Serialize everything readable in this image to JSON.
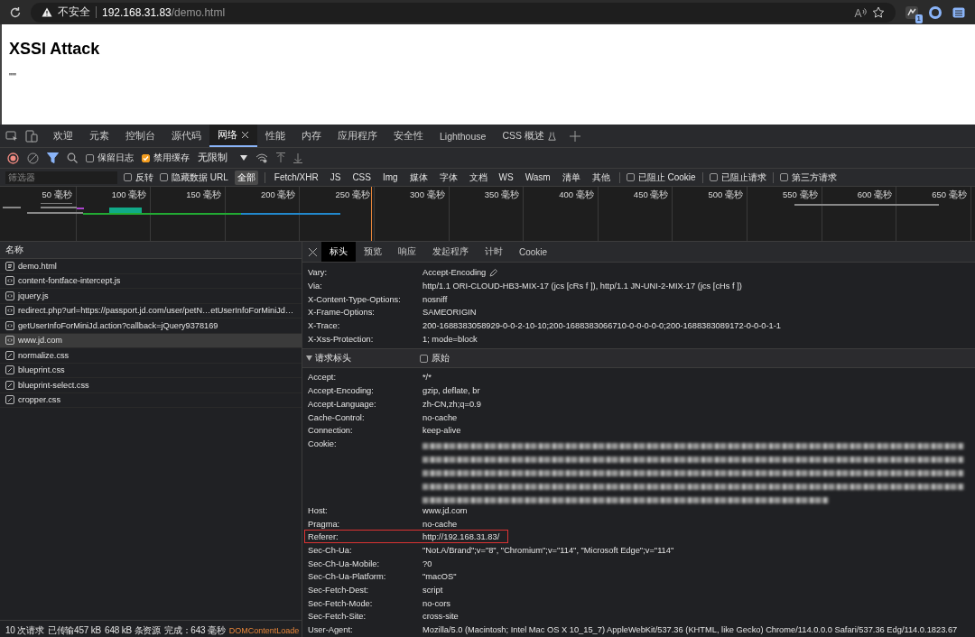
{
  "browser": {
    "security_label": "不安全",
    "url_host": "192.168.31.83",
    "url_path": "/demo.html",
    "extension_badge": "1"
  },
  "page": {
    "heading": "XSSI Attack",
    "body_text": "\"\""
  },
  "devtools_tabs": [
    {
      "label": "欢迎",
      "selected": false
    },
    {
      "label": "元素",
      "selected": false
    },
    {
      "label": "控制台",
      "selected": false
    },
    {
      "label": "源代码",
      "selected": false
    },
    {
      "label": "网络",
      "selected": true,
      "closable": true
    },
    {
      "label": "性能",
      "selected": false
    },
    {
      "label": "内存",
      "selected": false
    },
    {
      "label": "应用程序",
      "selected": false
    },
    {
      "label": "安全性",
      "selected": false
    },
    {
      "label": "Lighthouse",
      "selected": false
    },
    {
      "label": "CSS 概述",
      "selected": false,
      "experimental": true
    }
  ],
  "toolbar": {
    "recording": true,
    "filter_active": true,
    "preserve_log": {
      "label": "保留日志",
      "checked": false
    },
    "disable_cache": {
      "label": "禁用缓存",
      "checked": true
    },
    "throttling": "无限制"
  },
  "filter_bar": {
    "placeholder": "筛选器",
    "invert": {
      "label": "反转",
      "checked": false
    },
    "hide_data_urls": {
      "label": "隐藏数据 URL",
      "checked": false
    },
    "types": [
      {
        "label": "全部",
        "selected": true
      },
      {
        "label": "Fetch/XHR",
        "selected": false
      },
      {
        "label": "JS",
        "selected": false
      },
      {
        "label": "CSS",
        "selected": false
      },
      {
        "label": "Img",
        "selected": false
      },
      {
        "label": "媒体",
        "selected": false
      },
      {
        "label": "字体",
        "selected": false
      },
      {
        "label": "文档",
        "selected": false
      },
      {
        "label": "WS",
        "selected": false
      },
      {
        "label": "Wasm",
        "selected": false
      },
      {
        "label": "清单",
        "selected": false
      },
      {
        "label": "其他",
        "selected": false
      }
    ],
    "toggles": [
      {
        "label": "已阻止 Cookie",
        "checked": false
      },
      {
        "label": "已阻止请求",
        "checked": false
      },
      {
        "label": "第三方请求",
        "checked": false
      }
    ]
  },
  "timeline": {
    "ticks": [
      "50 毫秒",
      "100 毫秒",
      "150 毫秒",
      "200 毫秒",
      "250 毫秒",
      "300 毫秒",
      "350 毫秒",
      "400 毫秒",
      "450 毫秒",
      "500 毫秒",
      "550 毫秒",
      "600 毫秒",
      "650 毫秒"
    ]
  },
  "requests": {
    "column": "名称",
    "rows": [
      {
        "name": "demo.html",
        "kind": "document",
        "selected": false
      },
      {
        "name": "content-fontface-intercept.js",
        "kind": "script",
        "selected": false
      },
      {
        "name": "jquery.js",
        "kind": "script",
        "selected": false
      },
      {
        "name": "redirect.php?url=https://passport.jd.com/user/petN…etUserInfoForMiniJd…",
        "kind": "script",
        "selected": false
      },
      {
        "name": "getUserInfoForMiniJd.action?callback=jQuery9378169",
        "kind": "script",
        "selected": false
      },
      {
        "name": "www.jd.com",
        "kind": "script",
        "selected": true
      },
      {
        "name": "normalize.css",
        "kind": "stylesheet",
        "selected": false
      },
      {
        "name": "blueprint.css",
        "kind": "stylesheet",
        "selected": false
      },
      {
        "name": "blueprint-select.css",
        "kind": "stylesheet",
        "selected": false
      },
      {
        "name": "cropper.css",
        "kind": "stylesheet",
        "selected": false
      }
    ]
  },
  "status_bar": [
    "10 次请求",
    "已传输457 kB",
    "648 kB 条资源",
    "完成：643 毫秒",
    "DOMContentLoade"
  ],
  "detail_tabs": [
    {
      "label": "标头",
      "selected": true
    },
    {
      "label": "预览",
      "selected": false
    },
    {
      "label": "响应",
      "selected": false
    },
    {
      "label": "发起程序",
      "selected": false
    },
    {
      "label": "计时",
      "selected": false
    },
    {
      "label": "Cookie",
      "selected": false
    }
  ],
  "response_headers": [
    {
      "name": "Vary:",
      "value": "Accept-Encoding",
      "kind": "editable",
      "highlighted": false
    },
    {
      "name": "Via:",
      "value": "http/1.1 ORI-CLOUD-HB3-MIX-17 (jcs [cRs f ]), http/1.1 JN-UNI-2-MIX-17 (jcs [cHs f ])",
      "kind": "text",
      "highlighted": false
    },
    {
      "name": "X-Content-Type-Options:",
      "value": "nosniff",
      "kind": "text",
      "highlighted": false
    },
    {
      "name": "X-Frame-Options:",
      "value": "SAMEORIGIN",
      "kind": "text",
      "highlighted": false
    },
    {
      "name": "X-Trace:",
      "value": "200-1688383058929-0-0-2-10-10;200-1688383066710-0-0-0-0-0;200-1688383089172-0-0-0-1-1",
      "kind": "text",
      "highlighted": false
    },
    {
      "name": "X-Xss-Protection:",
      "value": "1; mode=block",
      "kind": "text",
      "highlighted": false
    }
  ],
  "request_section": {
    "title": "请求标头",
    "expanded": true,
    "raw": {
      "label": "原始",
      "checked": false
    }
  },
  "request_headers": [
    {
      "name": "Accept:",
      "value": "*/*",
      "kind": "text",
      "highlighted": false
    },
    {
      "name": "Accept-Encoding:",
      "value": "gzip, deflate, br",
      "kind": "text",
      "highlighted": false
    },
    {
      "name": "Accept-Language:",
      "value": "zh-CN,zh;q=0.9",
      "kind": "text",
      "highlighted": false
    },
    {
      "name": "Cache-Control:",
      "value": "no-cache",
      "kind": "text",
      "highlighted": false
    },
    {
      "name": "Connection:",
      "value": "keep-alive",
      "kind": "text",
      "highlighted": false
    },
    {
      "name": "Cookie:",
      "kind": "redacted",
      "highlighted": false
    },
    {
      "name": "Host:",
      "value": "www.jd.com",
      "kind": "text",
      "highlighted": false
    },
    {
      "name": "Pragma:",
      "value": "no-cache",
      "kind": "text",
      "highlighted": false
    },
    {
      "name": "Referer:",
      "value": "http://192.168.31.83/",
      "kind": "text",
      "highlighted": true
    },
    {
      "name": "Sec-Ch-Ua:",
      "value": "\"Not.A/Brand\";v=\"8\", \"Chromium\";v=\"114\", \"Microsoft Edge\";v=\"114\"",
      "kind": "text",
      "highlighted": false
    },
    {
      "name": "Sec-Ch-Ua-Mobile:",
      "value": "?0",
      "kind": "text",
      "highlighted": false
    },
    {
      "name": "Sec-Ch-Ua-Platform:",
      "value": "\"macOS\"",
      "kind": "text",
      "highlighted": false
    },
    {
      "name": "Sec-Fetch-Dest:",
      "value": "script",
      "kind": "text",
      "highlighted": false
    },
    {
      "name": "Sec-Fetch-Mode:",
      "value": "no-cors",
      "kind": "text",
      "highlighted": false
    },
    {
      "name": "Sec-Fetch-Site:",
      "value": "cross-site",
      "kind": "text",
      "highlighted": false
    },
    {
      "name": "User-Agent:",
      "value": "Mozilla/5.0 (Macintosh; Intel Mac OS X 10_15_7) AppleWebKit/537.36 (KHTML, like Gecko) Chrome/114.0.0.0 Safari/537.36 Edg/114.0.1823.67",
      "kind": "text",
      "highlighted": false
    }
  ]
}
